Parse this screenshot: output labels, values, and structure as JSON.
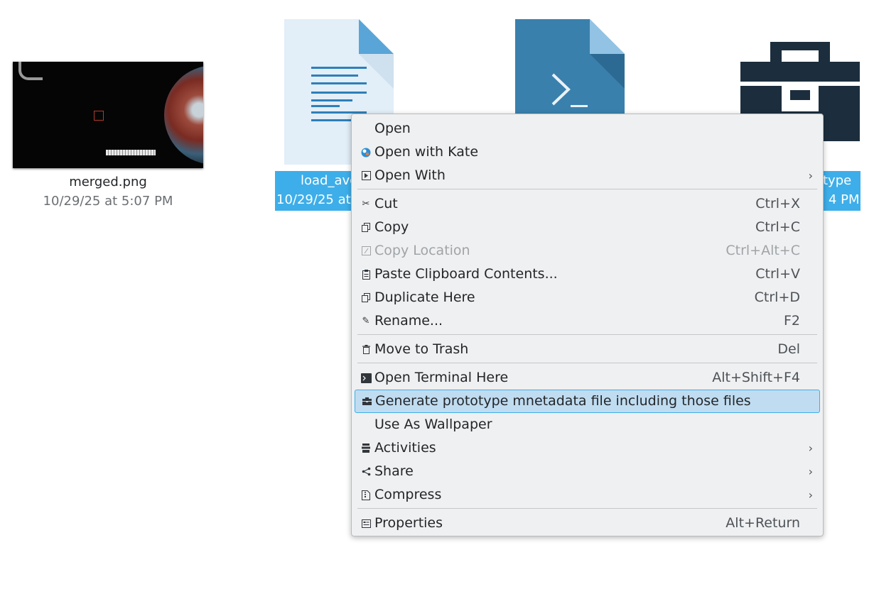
{
  "desktop": {
    "items": [
      {
        "name": "merged.png",
        "date": "10/29/25 at 5:07 PM"
      },
      {
        "name": "load_avg",
        "date": "10/29/25 at"
      },
      {
        "name": "",
        "date": ""
      },
      {
        "name": "type",
        "date": "4 PM"
      }
    ]
  },
  "menu": {
    "open": {
      "label": "Open"
    },
    "open_with_kate": {
      "label": "Open with Kate"
    },
    "open_with": {
      "label": "Open With"
    },
    "cut": {
      "label": "Cut",
      "shortcut": "Ctrl+X"
    },
    "copy": {
      "label": "Copy",
      "shortcut": "Ctrl+C"
    },
    "copy_location": {
      "label": "Copy Location",
      "shortcut": "Ctrl+Alt+C"
    },
    "paste": {
      "label": "Paste Clipboard Contents...",
      "shortcut": "Ctrl+V"
    },
    "duplicate": {
      "label": "Duplicate Here",
      "shortcut": "Ctrl+D"
    },
    "rename": {
      "label": "Rename...",
      "shortcut": "F2"
    },
    "trash": {
      "label": "Move to Trash",
      "shortcut": "Del"
    },
    "terminal": {
      "label": "Open Terminal Here",
      "shortcut": "Alt+Shift+F4"
    },
    "generate": {
      "label": "Generate prototype mnetadata file including those files"
    },
    "wallpaper": {
      "label": "Use As Wallpaper"
    },
    "activities": {
      "label": "Activities"
    },
    "share": {
      "label": "Share"
    },
    "compress": {
      "label": "Compress"
    },
    "properties": {
      "label": "Properties",
      "shortcut": "Alt+Return"
    }
  },
  "colors": {
    "selection": "#3daee9",
    "menu_bg": "#eff0f1",
    "highlight": "#c0dcf1"
  }
}
